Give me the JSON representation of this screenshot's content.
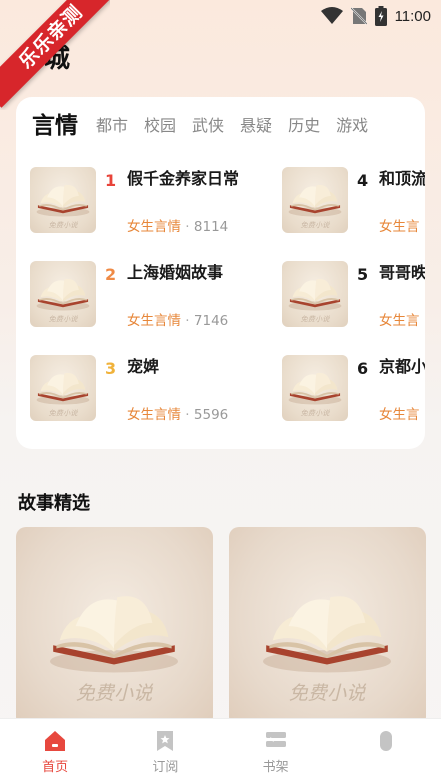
{
  "status": {
    "time": "11:00"
  },
  "ribbon": {
    "text": "乐乐亲测"
  },
  "page": {
    "title": "书城"
  },
  "categories": [
    "言情",
    "都市",
    "校园",
    "武侠",
    "悬疑",
    "历史",
    "游戏"
  ],
  "books": [
    {
      "rank": "1",
      "title": "假千金养家日常",
      "category": "女生言情",
      "dot": "·",
      "count": "8114",
      "rank_color": "#e8443a"
    },
    {
      "rank": "2",
      "title": "上海婚姻故事",
      "category": "女生言情",
      "dot": "·",
      "count": "7146",
      "rank_color": "#ef8a45"
    },
    {
      "rank": "3",
      "title": "宠婢",
      "category": "女生言情",
      "dot": "·",
      "count": "5596",
      "rank_color": "#f0b23a"
    },
    {
      "rank": "4",
      "title": "和顶流忆了",
      "category": "女生言",
      "dot": "",
      "count": "",
      "rank_color": "#1a1a1a"
    },
    {
      "rank": "5",
      "title": "哥哥昳",
      "category": "女生言",
      "dot": "",
      "count": "",
      "rank_color": "#1a1a1a"
    },
    {
      "rank": "6",
      "title": "京都小",
      "category": "女生言",
      "dot": "",
      "count": "",
      "rank_color": "#1a1a1a"
    }
  ],
  "section": {
    "title": "故事精选"
  },
  "cover_watermark": "免费小说",
  "tabs": [
    {
      "label": "首页",
      "icon": "home-icon",
      "active": true
    },
    {
      "label": "订阅",
      "icon": "bookmark-icon",
      "active": false
    },
    {
      "label": "书架",
      "icon": "bookshelf-icon",
      "active": false
    },
    {
      "label": "",
      "icon": "profile-icon",
      "active": false
    }
  ],
  "colors": {
    "accent": "#e7483e",
    "category": "#e7873a"
  }
}
